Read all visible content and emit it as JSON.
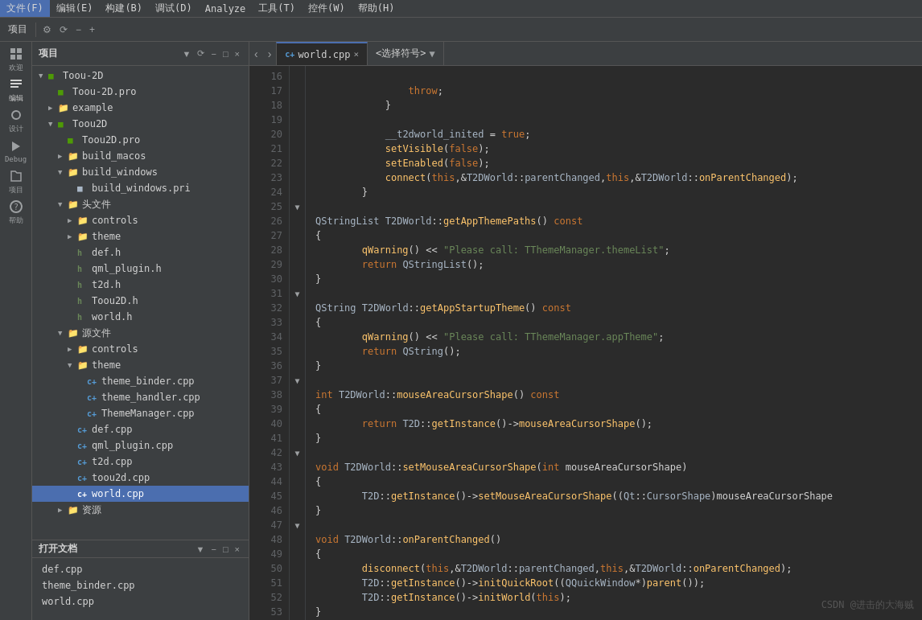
{
  "menubar": {
    "items": [
      "文件(F)",
      "编辑(E)",
      "构建(B)",
      "调试(D)",
      "Analyze",
      "工具(T)",
      "控件(W)",
      "帮助(H)"
    ]
  },
  "project_panel": {
    "title": "项目",
    "tree": [
      {
        "id": "toou2d_root",
        "label": "Toou-2D",
        "indent": 0,
        "type": "root",
        "expanded": true
      },
      {
        "id": "toou2d_pro",
        "label": "Toou-2D.pro",
        "indent": 1,
        "type": "pro"
      },
      {
        "id": "example",
        "label": "example",
        "indent": 1,
        "type": "folder",
        "expanded": false
      },
      {
        "id": "toou2d_folder",
        "label": "Toou2D",
        "indent": 1,
        "type": "folder",
        "expanded": true
      },
      {
        "id": "toou2d_pro2",
        "label": "Toou2D.pro",
        "indent": 2,
        "type": "pro"
      },
      {
        "id": "build_macos",
        "label": "build_macos",
        "indent": 2,
        "type": "folder",
        "expanded": false
      },
      {
        "id": "build_windows",
        "label": "build_windows",
        "indent": 2,
        "type": "folder",
        "expanded": true
      },
      {
        "id": "build_windows_pri",
        "label": "build_windows.pri",
        "indent": 3,
        "type": "pri"
      },
      {
        "id": "headers",
        "label": "头文件",
        "indent": 2,
        "type": "folder",
        "expanded": true
      },
      {
        "id": "controls",
        "label": "controls",
        "indent": 3,
        "type": "folder",
        "expanded": false
      },
      {
        "id": "theme_h",
        "label": "theme",
        "indent": 3,
        "type": "folder",
        "expanded": false
      },
      {
        "id": "def_h",
        "label": "def.h",
        "indent": 3,
        "type": "h"
      },
      {
        "id": "qml_plugin_h",
        "label": "qml_plugin.h",
        "indent": 3,
        "type": "h"
      },
      {
        "id": "t2d_h",
        "label": "t2d.h",
        "indent": 3,
        "type": "h"
      },
      {
        "id": "toou2d_h",
        "label": "Toou2D.h",
        "indent": 3,
        "type": "h"
      },
      {
        "id": "world_h",
        "label": "world.h",
        "indent": 3,
        "type": "h"
      },
      {
        "id": "sources",
        "label": "源文件",
        "indent": 2,
        "type": "folder",
        "expanded": true
      },
      {
        "id": "controls_src",
        "label": "controls",
        "indent": 3,
        "type": "folder",
        "expanded": false
      },
      {
        "id": "theme_src",
        "label": "theme",
        "indent": 3,
        "type": "folder",
        "expanded": true
      },
      {
        "id": "theme_binder_cpp",
        "label": "theme_binder.cpp",
        "indent": 4,
        "type": "cpp"
      },
      {
        "id": "theme_handler_cpp",
        "label": "theme_handler.cpp",
        "indent": 4,
        "type": "cpp"
      },
      {
        "id": "thememanager_cpp",
        "label": "ThemeManager.cpp",
        "indent": 4,
        "type": "cpp"
      },
      {
        "id": "def_cpp",
        "label": "def.cpp",
        "indent": 3,
        "type": "cpp"
      },
      {
        "id": "qml_plugin_cpp",
        "label": "qml_plugin.cpp",
        "indent": 3,
        "type": "cpp"
      },
      {
        "id": "t2d_cpp",
        "label": "t2d.cpp",
        "indent": 3,
        "type": "cpp"
      },
      {
        "id": "toou2d_cpp",
        "label": "toou2d.cpp",
        "indent": 3,
        "type": "cpp"
      },
      {
        "id": "world_cpp",
        "label": "world.cpp",
        "indent": 3,
        "type": "cpp",
        "selected": true
      },
      {
        "id": "resources",
        "label": "资源",
        "indent": 2,
        "type": "folder",
        "expanded": false
      }
    ]
  },
  "open_docs": {
    "title": "打开文档",
    "files": [
      "def.cpp",
      "theme_binder.cpp",
      "world.cpp"
    ]
  },
  "editor": {
    "tab_label": "world.cpp",
    "symbol_placeholder": "<选择符号>",
    "lines": [
      {
        "num": 16,
        "fold": false,
        "code": "                <span class='kw'>throw</span>;"
      },
      {
        "num": 17,
        "fold": false,
        "code": "            <span class='punct'>}</span>"
      },
      {
        "num": 18,
        "fold": false,
        "code": ""
      },
      {
        "num": 19,
        "fold": false,
        "code": "            <span class='ns'>__t2dworld_inited</span> = <span class='kw'>true</span>;"
      },
      {
        "num": 20,
        "fold": false,
        "code": "            <span class='fn'>setVisible</span>(<span class='kw'>false</span>);"
      },
      {
        "num": 21,
        "fold": false,
        "code": "            <span class='fn'>setEnabled</span>(<span class='kw'>false</span>);"
      },
      {
        "num": 22,
        "fold": false,
        "code": "            <span class='fn'>connect</span>(<span class='kw'>this</span>,<span class='op'>&amp;</span><span class='cls'>T2DWorld</span>::<span class='ns'>parentChanged</span>,<span class='kw'>this</span>,<span class='op'>&amp;</span><span class='cls'>T2DWorld</span>::<span class='fn'>onParentChanged</span>);"
      },
      {
        "num": 23,
        "fold": false,
        "code": "        <span class='punct'>}</span>"
      },
      {
        "num": 24,
        "fold": false,
        "code": ""
      },
      {
        "num": 25,
        "fold": true,
        "code": "<span class='cls'>QStringList</span> <span class='cls'>T2DWorld</span>::<span class='fn'>getAppThemePaths</span>() <span class='kw'>const</span>"
      },
      {
        "num": 26,
        "fold": false,
        "code": "<span class='punct'>{</span>"
      },
      {
        "num": 27,
        "fold": false,
        "code": "        <span class='fn'>qWarning</span>() <span class='op'>&lt;&lt;</span> <span class='str'>\"Please call: TThemeManager.themeList\"</span>;"
      },
      {
        "num": 28,
        "fold": false,
        "code": "        <span class='kw'>return</span> <span class='cls'>QStringList</span>();"
      },
      {
        "num": 29,
        "fold": false,
        "code": "<span class='punct'>}</span>"
      },
      {
        "num": 30,
        "fold": false,
        "code": ""
      },
      {
        "num": 31,
        "fold": true,
        "code": "<span class='cls'>QString</span> <span class='cls'>T2DWorld</span>::<span class='fn'>getAppStartupTheme</span>() <span class='kw'>const</span>"
      },
      {
        "num": 32,
        "fold": false,
        "code": "<span class='punct'>{</span>"
      },
      {
        "num": 33,
        "fold": false,
        "code": "        <span class='fn'>qWarning</span>() <span class='op'>&lt;&lt;</span> <span class='str'>\"Please call: TThemeManager.appTheme\"</span>;"
      },
      {
        "num": 34,
        "fold": false,
        "code": "        <span class='kw'>return</span> <span class='cls'>QString</span>();"
      },
      {
        "num": 35,
        "fold": false,
        "code": "<span class='punct'>}</span>"
      },
      {
        "num": 36,
        "fold": false,
        "code": ""
      },
      {
        "num": 37,
        "fold": true,
        "code": "<span class='kw'>int</span> <span class='cls'>T2DWorld</span>::<span class='fn'>mouseAreaCursorShape</span>() <span class='kw'>const</span>"
      },
      {
        "num": 38,
        "fold": false,
        "code": "<span class='punct'>{</span>"
      },
      {
        "num": 39,
        "fold": false,
        "code": "        <span class='kw'>return</span> <span class='cls'>T2D</span>::<span class='fn'>getInstance</span>()-><span class='fn'>mouseAreaCursorShape</span>();"
      },
      {
        "num": 40,
        "fold": false,
        "code": "<span class='punct'>}</span>"
      },
      {
        "num": 41,
        "fold": false,
        "code": ""
      },
      {
        "num": 42,
        "fold": true,
        "code": "<span class='kw'>void</span> <span class='cls'>T2DWorld</span>::<span class='fn'>setMouseAreaCursorShape</span>(<span class='kw'>int</span> mouseAreaCursorShape)"
      },
      {
        "num": 43,
        "fold": false,
        "code": "<span class='punct'>{</span>"
      },
      {
        "num": 44,
        "fold": false,
        "code": "        <span class='cls'>T2D</span>::<span class='fn'>getInstance</span>()-><span class='fn'>setMouseAreaCursorShape</span>((<span class='cls'>Qt</span>::<span class='cls'>CursorShape</span>)mouseAreaCursorShape"
      },
      {
        "num": 45,
        "fold": false,
        "code": "<span class='punct'>}</span>"
      },
      {
        "num": 46,
        "fold": false,
        "code": ""
      },
      {
        "num": 47,
        "fold": true,
        "code": "<span class='kw'>void</span> <span class='cls'>T2DWorld</span>::<span class='fn'>onParentChanged</span>()"
      },
      {
        "num": 48,
        "fold": false,
        "code": "<span class='punct'>{</span>"
      },
      {
        "num": 49,
        "fold": false,
        "code": "        <span class='fn'>disconnect</span>(<span class='kw'>this</span>,<span class='op'>&amp;</span><span class='cls'>T2DWorld</span>::<span class='ns'>parentChanged</span>,<span class='kw'>this</span>,<span class='op'>&amp;</span><span class='cls'>T2DWorld</span>::<span class='fn'>onParentChanged</span>);"
      },
      {
        "num": 50,
        "fold": false,
        "code": "        <span class='cls'>T2D</span>::<span class='fn'>getInstance</span>()-><span class='fn'>initQuickRoot</span>((<span class='cls'>QQuickWindow</span>*)<span class='fn'>parent</span>());"
      },
      {
        "num": 51,
        "fold": false,
        "code": "        <span class='cls'>T2D</span>::<span class='fn'>getInstance</span>()-><span class='fn'>initWorld</span>(<span class='kw'>this</span>);"
      },
      {
        "num": 52,
        "fold": false,
        "code": "<span class='punct'>}</span>"
      },
      {
        "num": 53,
        "fold": false,
        "code": ""
      }
    ]
  },
  "watermark": "CSDN @进击的大海贼",
  "sidebar_icons": [
    {
      "id": "welcome",
      "label": "欢迎"
    },
    {
      "id": "edit",
      "label": "编辑"
    },
    {
      "id": "design",
      "label": "设计"
    },
    {
      "id": "debug",
      "label": "Debug"
    },
    {
      "id": "project",
      "label": "项目"
    },
    {
      "id": "help",
      "label": "帮助"
    }
  ]
}
